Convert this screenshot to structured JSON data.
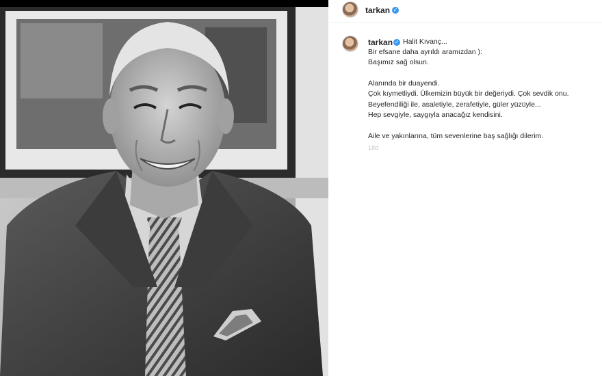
{
  "header": {
    "username": "tarkan",
    "verified": true
  },
  "caption": {
    "username": "tarkan",
    "mention": "Halit Kıvanç...",
    "lines": [
      "Bir efsane daha ayrıldı aramızdan ):",
      "Başımız sağ olsun.",
      "Alanında bir duayendi.",
      "Çok kıymetliydi. Ülkemizin büyük bir değeriydi. Çok sevdik onu.",
      "Beyefendiliği ile, asaletiyle, zerafetiyle, güler yüzüyle...",
      "Hep sevgiyle, saygıyla anacağız kendisini.",
      "Aile ve yakınlarına, tüm sevenlerine baş sağlığı dilerim."
    ],
    "time": "18d"
  },
  "colors": {
    "verified_badge": "#3897f0",
    "text": "#262626",
    "muted": "#c7c7c7"
  }
}
